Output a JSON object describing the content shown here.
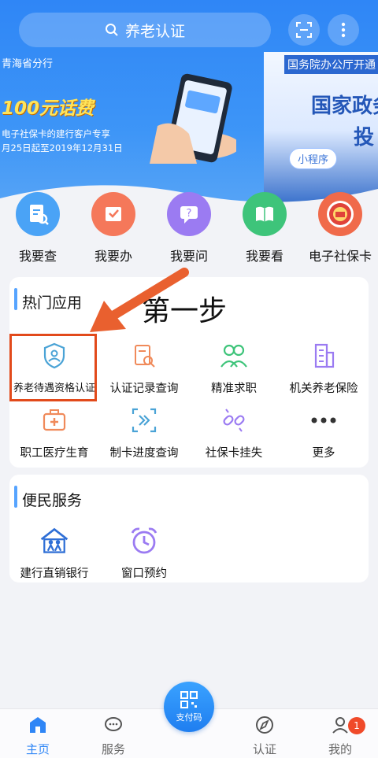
{
  "search": {
    "text": "养老认证"
  },
  "banner": {
    "branch": "青海省分行",
    "promo": "100元话费",
    "desc": "电子社保卡的建行客户专享",
    "date": "月25日起至2019年12月31日",
    "right_head": "国务院办公厅开通",
    "right_big1": "国家政务",
    "right_big2": "投",
    "mini_program": "小程序"
  },
  "quick": [
    {
      "label": "我要查",
      "color": "#4aa3f6"
    },
    {
      "label": "我要办",
      "color": "#f5785a"
    },
    {
      "label": "我要问",
      "color": "#9b7bf2"
    },
    {
      "label": "我要看",
      "color": "#3ec47a"
    },
    {
      "label": "电子社保卡",
      "color": "#f06a4a"
    }
  ],
  "hot": {
    "title": "热门应用",
    "items": [
      "养老待遇资格认证",
      "认证记录查询",
      "精准求职",
      "机关养老保险",
      "职工医疗生育",
      "制卡进度查询",
      "社保卡挂失",
      "更多"
    ]
  },
  "annotation": {
    "step": "第一步"
  },
  "service": {
    "title": "便民服务",
    "items": [
      "建行直销银行",
      "窗口预约"
    ]
  },
  "tabs": {
    "home": "主页",
    "service": "服务",
    "pay": "支付码",
    "auth": "认证",
    "mine": "我的",
    "badge": "1"
  },
  "colors": {
    "primary": "#2f86f6",
    "highlight": "#e24a1b"
  }
}
